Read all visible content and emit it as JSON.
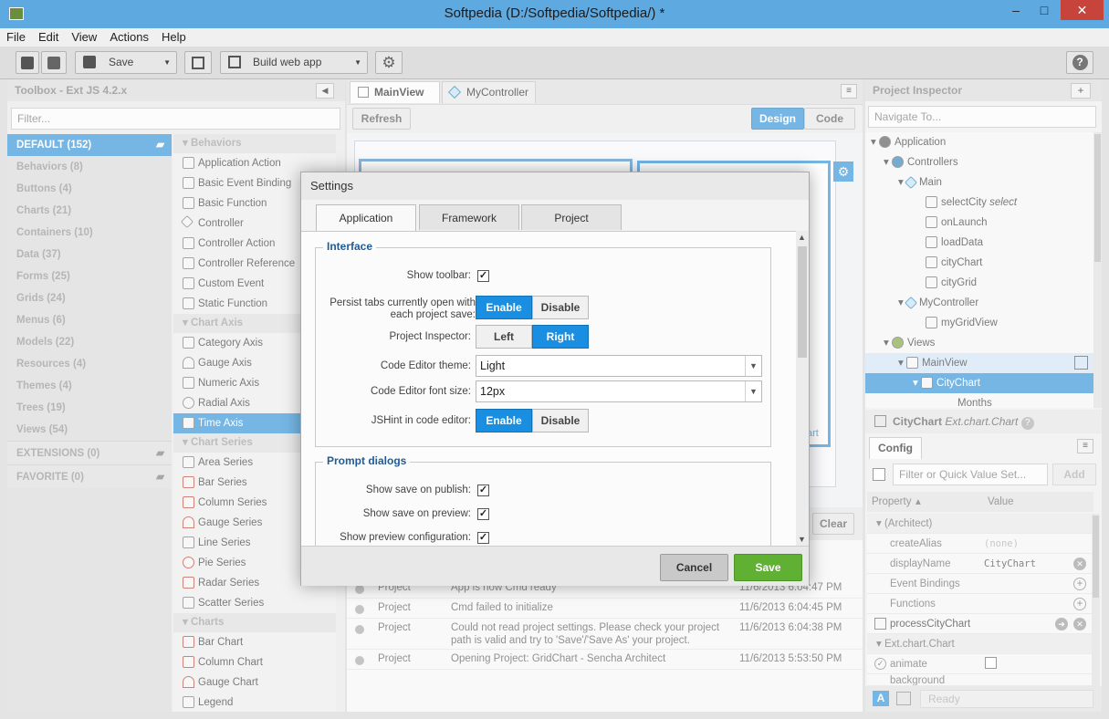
{
  "window": {
    "title": "Softpedia (D:/Softpedia/Softpedia/) *",
    "min": "–",
    "max": "□",
    "close": "✕"
  },
  "menu": [
    "File",
    "Edit",
    "View",
    "Actions",
    "Help"
  ],
  "toolbar": {
    "save_label": "Save",
    "build_label": "Build web app",
    "help": "?"
  },
  "toolbox": {
    "title": "Toolbox - Ext JS 4.2.x",
    "filter_placeholder": "Filter...",
    "categories": [
      "DEFAULT (152)",
      "Behaviors (8)",
      "Buttons (4)",
      "Charts (21)",
      "Containers (10)",
      "Data (37)",
      "Forms (25)",
      "Grids (24)",
      "Menus (6)",
      "Models (22)",
      "Resources (4)",
      "Themes (4)",
      "Trees (19)",
      "Views (54)"
    ],
    "extensions": "EXTENSIONS (0)",
    "favorite": "FAVORITE (0)",
    "groups": [
      {
        "title": "Behaviors",
        "items": [
          "Application Action",
          "Basic Event Binding",
          "Basic Function",
          "Controller",
          "Controller Action",
          "Controller Reference",
          "Custom Event",
          "Static Function"
        ]
      },
      {
        "title": "Chart Axis",
        "items": [
          "Category Axis",
          "Gauge Axis",
          "Numeric Axis",
          "Radial Axis",
          "Time Axis"
        ]
      },
      {
        "title": "Chart Series",
        "items": [
          "Area Series",
          "Bar Series",
          "Column Series",
          "Gauge Series",
          "Line Series",
          "Pie Series",
          "Radar Series",
          "Scatter Series"
        ]
      },
      {
        "title": "Charts",
        "items": [
          "Bar Chart",
          "Column Chart",
          "Gauge Chart",
          "Legend"
        ]
      }
    ]
  },
  "center": {
    "tabs": [
      "MainView",
      "MyController"
    ],
    "refresh": "Refresh",
    "design": "Design",
    "code": "Code",
    "clear": "Clear",
    "chart_tail": "art",
    "log": [
      {
        "source": "Project",
        "message": "App is now Cmd ready",
        "time": "11/6/2013 6:04:47 PM"
      },
      {
        "source": "Project",
        "message": "Cmd failed to initialize",
        "time": "11/6/2013 6:04:45 PM"
      },
      {
        "source": "Project",
        "message": "Could not read project settings. Please check your project path is valid and try to 'Save'/'Save As' your project.",
        "time": "11/6/2013 6:04:38 PM"
      },
      {
        "source": "Project",
        "message": "Opening Project: GridChart - Sencha Architect",
        "time": "11/6/2013 5:53:50 PM"
      }
    ]
  },
  "inspector": {
    "title": "Project Inspector",
    "add": "+",
    "navigate_placeholder": "Navigate To...",
    "nodes": [
      "Application",
      "Controllers",
      "Main",
      "selectCity",
      "select",
      "onLaunch",
      "loadData",
      "cityChart",
      "cityGrid",
      "MyController",
      "myGridView",
      "Views",
      "MainView",
      "CityChart",
      "Months"
    ]
  },
  "config": {
    "component": "CityChart",
    "component_type": "Ext.chart.Chart",
    "tab": "Config",
    "filter_placeholder": "Filter or Quick Value Set...",
    "add": "Add",
    "col_property": "Property",
    "col_value": "Value",
    "rows": [
      {
        "name": "(Architect)",
        "value": ""
      },
      {
        "name": "createAlias",
        "value": "(none)"
      },
      {
        "name": "displayName",
        "value": "CityChart"
      },
      {
        "name": "Event Bindings",
        "value": ""
      },
      {
        "name": "Functions",
        "value": ""
      },
      {
        "name": "processCityChart",
        "value": ""
      },
      {
        "name": "Ext.chart.Chart",
        "value": ""
      },
      {
        "name": "animate",
        "value": ""
      },
      {
        "name": "background",
        "value": ""
      }
    ],
    "status": "Ready"
  },
  "dialog": {
    "title": "Settings",
    "tabs": [
      "Application",
      "Framework",
      "Project"
    ],
    "interface": {
      "legend": "Interface",
      "show_toolbar": "Show toolbar:",
      "persist_tabs": "Persist tabs currently open with each project save:",
      "enable": "Enable",
      "disable": "Disable",
      "project_inspector": "Project Inspector:",
      "left": "Left",
      "right": "Right",
      "editor_theme_label": "Code Editor theme:",
      "editor_theme": "Light",
      "font_size_label": "Code Editor font size:",
      "font_size": "12px",
      "jshint": "JSHint in code editor:"
    },
    "prompts": {
      "legend": "Prompt dialogs",
      "save_publish": "Show save on publish:",
      "save_preview": "Show save on preview:",
      "preview_config": "Show preview configuration:"
    },
    "cancel": "Cancel",
    "save": "Save"
  }
}
